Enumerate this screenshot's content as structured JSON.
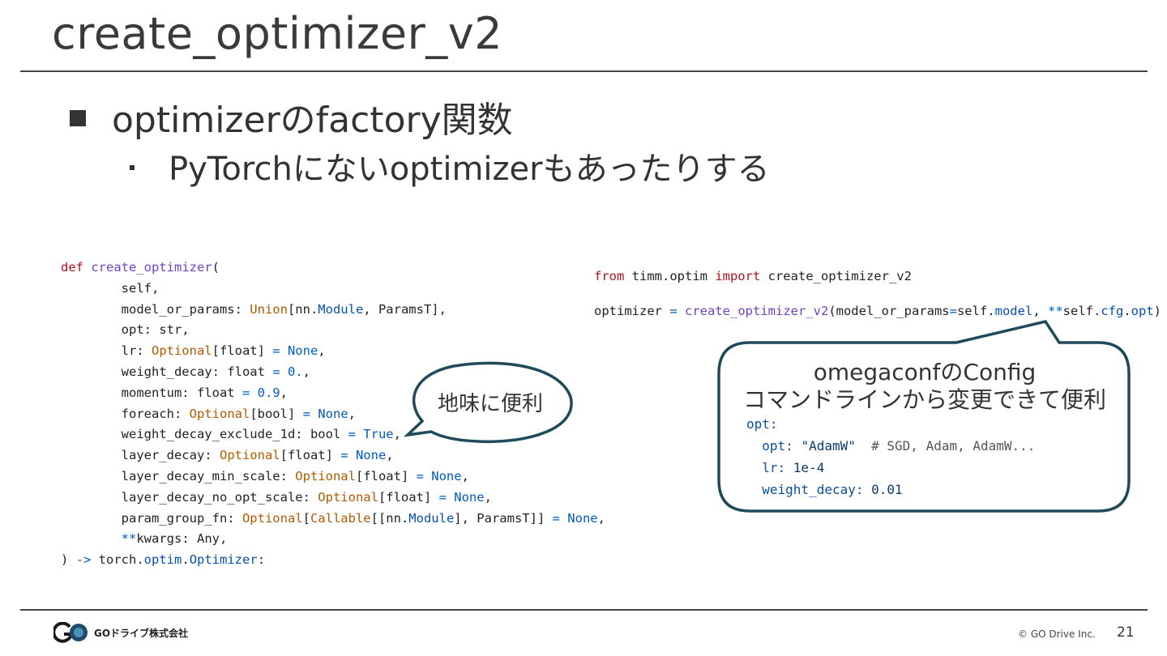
{
  "slide": {
    "title": "create_optimizer_v2",
    "bullet1": "optimizerのfactory関数",
    "bullet2": "PyTorchにないoptimizerもあったりする"
  },
  "code_left": {
    "line1_kw": "def",
    "line1_fn": "create_optimizer",
    "line1_rest": "(",
    "l2": "self,",
    "l3a": "model_or_params: ",
    "l3b": "Union",
    "l3c": "[nn.",
    "l3d": "Module",
    "l3e": ", ParamsT],",
    "l4": "opt: str,",
    "l5a": "lr: ",
    "l5b": "Optional",
    "l5c": "[float] ",
    "l5d": "= None",
    "l5e": ",",
    "l6a": "weight_decay: float ",
    "l6b": "= 0.",
    "l6c": ",",
    "l7a": "momentum: float ",
    "l7b": "= 0.9",
    "l7c": ",",
    "l8a": "foreach: ",
    "l8b": "Optional",
    "l8c": "[bool] ",
    "l8d": "= None",
    "l8e": ",",
    "l9a": "weight_decay_exclude_1d: bool ",
    "l9b": "= True",
    "l9c": ",",
    "l10a": "layer_decay: ",
    "l10b": "Optional",
    "l10c": "[float] ",
    "l10d": "= None",
    "l10e": ",",
    "l11a": "layer_decay_min_scale: ",
    "l11b": "Optional",
    "l11c": "[float] ",
    "l11d": "= None",
    "l11e": ",",
    "l12a": "layer_decay_no_opt_scale: ",
    "l12b": "Optional",
    "l12c": "[float] ",
    "l12d": "= None",
    "l12e": ",",
    "l13a": "param_group_fn: ",
    "l13b": "Optional",
    "l13c": "[",
    "l13d": "Callable",
    "l13e": "[[nn.",
    "l13f": "Module",
    "l13g": "], ParamsT]] ",
    "l13h": "= None",
    "l13i": ",",
    "l14a": "**",
    "l14b": "kwargs: Any,",
    "l15a": ") ",
    "l15b": "->",
    "l15c": " torch.",
    "l15d": "optim",
    "l15e": ".",
    "l15f": "Optimizer",
    "l15g": ":"
  },
  "code_right": {
    "r1a": "from",
    "r1b": " timm.optim ",
    "r1c": "import",
    "r1d": " create_optimizer_v2",
    "r2a": "optimizer ",
    "r2b": "=",
    "r2c": " create_optimizer_v2",
    "r2d": "(model_or_params",
    "r2e": "=",
    "r2f": "self.",
    "r2g": "model",
    "r2h": ", ",
    "r2i": "**",
    "r2j": "self.",
    "r2k": "cfg",
    "r2l": ".",
    "r2m": "opt",
    "r2n": ")"
  },
  "bubble_small": {
    "text": "地味に便利"
  },
  "bubble_big": {
    "line1": "omegaconfのConfig",
    "line2": "コマンドラインから変更できて便利",
    "y1": "opt:",
    "y2a": "  opt: ",
    "y2b": "\"AdamW\"",
    "y2c": "  # SGD, Adam, AdamW...",
    "y3a": "  lr: ",
    "y3b": "1e-4",
    "y4a": "  weight_decay: ",
    "y4b": "0.01"
  },
  "footer": {
    "company": "GOドライブ株式会社",
    "copyright": "© GO Drive Inc.",
    "page_number": "21"
  },
  "colors": {
    "accent_bubble": "#1f4a5a",
    "keyword": "#b3121e",
    "function": "#6f42c1"
  }
}
